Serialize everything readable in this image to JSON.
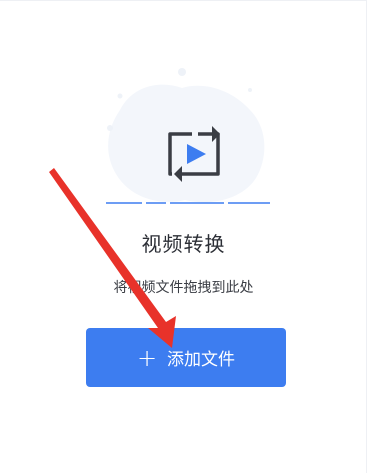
{
  "upload_panel": {
    "title": "视频转换",
    "hint": "将视频文件拖拽到此处",
    "add_button": {
      "icon": "+",
      "label": "添加文件"
    }
  },
  "colors": {
    "accent": "#3d7df0",
    "annotation_arrow": "#e8322a"
  },
  "icons": {
    "illustration": "video-convert-icon",
    "add": "plus-icon",
    "annotation": "red-arrow-annotation"
  }
}
